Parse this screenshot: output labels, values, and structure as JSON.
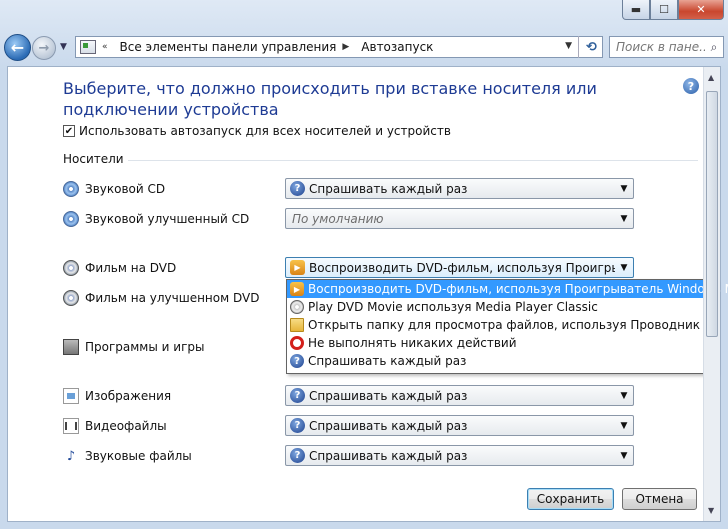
{
  "window": {
    "min_label": "▬",
    "max_label": "☐",
    "close_label": "✕"
  },
  "nav": {
    "back_label": "←",
    "forward_label": "→",
    "breadcrumb": [
      "Все элементы панели управления",
      "Автозапуск"
    ],
    "search_placeholder": "Поиск в пане..."
  },
  "page": {
    "title": "Выберите, что должно происходить при вставке носителя или подключении устройства",
    "help_label": "?",
    "autoplay_checkbox_label": "Использовать автозапуск для всех носителей и устройств",
    "autoplay_checked": true,
    "group_media": "Носители"
  },
  "media": [
    {
      "label": "Звуковой CD",
      "icon": "cd-icon",
      "value": "Спрашивать каждый раз",
      "value_icon": "question-icon"
    },
    {
      "label": "Звуковой улучшенный CD",
      "icon": "cd-icon",
      "value": "По умолчанию",
      "value_icon": "",
      "disabled": true
    },
    {
      "label": "Фильм на DVD",
      "icon": "dvd-icon",
      "value": "Воспроизводить DVD-фильм, используя Проигрывател",
      "value_icon": "media-player-icon",
      "open": true
    },
    {
      "label": "Фильм на улучшенном DVD",
      "icon": "dvd-icon"
    },
    {
      "label": "Программы и игры",
      "icon": "programs-icon"
    },
    {
      "label": "Изображения",
      "icon": "image-file-icon",
      "value": "Спрашивать каждый раз",
      "value_icon": "question-icon"
    },
    {
      "label": "Видеофайлы",
      "icon": "video-file-icon",
      "value": "Спрашивать каждый раз",
      "value_icon": "question-icon"
    },
    {
      "label": "Звуковые файлы",
      "icon": "audio-file-icon",
      "value": "Спрашивать каждый раз",
      "value_icon": "question-icon"
    }
  ],
  "dropdown_options": [
    {
      "label": "Воспроизводить DVD-фильм, используя Проигрыватель Windows Media",
      "icon": "media-player-icon",
      "selected": true
    },
    {
      "label": "Play DVD Movie используя Media Player Classic",
      "icon": "dvd-disc-icon"
    },
    {
      "label": "Открыть папку для просмотра файлов, используя Проводник",
      "icon": "folder-icon"
    },
    {
      "label": "Не выполнять никаких действий",
      "icon": "no-action-icon"
    },
    {
      "label": "Спрашивать каждый раз",
      "icon": "question-icon"
    }
  ],
  "buttons": {
    "save": "Сохранить",
    "cancel": "Отмена"
  }
}
